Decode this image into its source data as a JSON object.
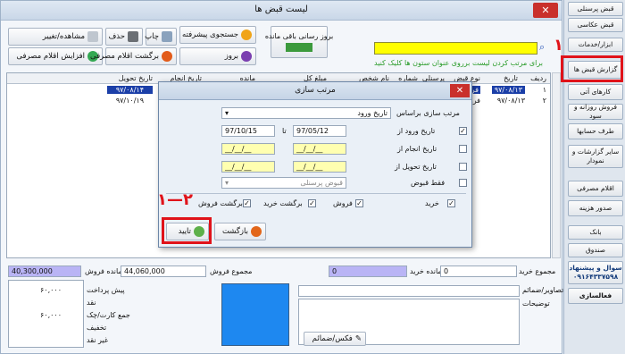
{
  "window": {
    "title": "لیست قبض ها",
    "close": "✕"
  },
  "toolbar": {
    "view_edit": "مشاهده/تغییر",
    "delete": "حذف",
    "print": "چاپ",
    "advanced_search": "جستجوی پیشرفته",
    "remaining_update": "بروز رسانی باقی مانده",
    "add_consumables": "افزایش اقلام مصرفی",
    "return_consumables": "برگشت اقلام مصرفی",
    "update": "بروز",
    "sort_hint": "برای مرتب کردن لیست برروی عنوان ستون ها کلیک کنید"
  },
  "grid": {
    "columns": [
      "ردیف",
      "تاریخ",
      "نوع قبض",
      "پرسنلی",
      "شماره",
      "نام شخص",
      "مبلغ کل",
      "مانده",
      "تاریخ انجام",
      "تاریخ تحویل"
    ],
    "rows": [
      {
        "idx": "۱",
        "date": "۹۷/۰۸/۱۳",
        "type": "فروش",
        "delivery": "۹۷/۰۸/۱۴"
      },
      {
        "idx": "۲",
        "date": "۹۷/۰۸/۱۳",
        "type": "فروش",
        "delivery": "۹۷/۱۰/۱۹"
      }
    ]
  },
  "dialog": {
    "title": "مرتب سازی",
    "sort_label": "مرتب سازی براساس",
    "sort_value": "تاریخ ورود",
    "entry_date": "تاریخ ورود از",
    "entry_from": "97/05/12",
    "entry_to": "97/10/15",
    "to": "تا",
    "done_date": "تاریخ انجام از",
    "delivery_date": "تاریخ تحویل از",
    "empty_date": "__/__/__",
    "only_receipts": "فقط قبوض",
    "personnel": "قبوض پرسنلی",
    "types": [
      "خرید",
      "فروش",
      "برگشت خرید",
      "برگشت فروش"
    ],
    "cancel": "بازگشت",
    "ok": "تایید"
  },
  "summary": {
    "total_purchase_label": "مجموع خرید",
    "total_purchase": "0",
    "remaining_purchase_label": "مانده خرید",
    "remaining_purchase": "0",
    "total_sales_label": "مجموع فروش",
    "total_sales": "44,060,000",
    "remaining_sales_label": "مانده فروش",
    "remaining_sales": "40,300,000",
    "prepayment": "پیش پرداخت",
    "prepayment_val": "۶۰,۰۰۰",
    "cash": "نقد",
    "card": "جمع کارت/چک",
    "card_val": "۶۰,۰۰۰",
    "discount": "تخفیف",
    "noncash": "غیر نقد",
    "image_path": "مسیر تصاویر/ضمائم",
    "notes": "توضیحات",
    "fax": "فکس/ضمائم"
  },
  "sidebar": {
    "items": [
      "قبض پرسنلی",
      "قبض عکاسی",
      "ابزار/خدمات",
      "گزارش قبض ها",
      "کارهای آتی",
      "فروش روزانه و سود",
      "طرف حسابها",
      "سایر گزارشات و نمودار",
      "اقلام مصرفی",
      "صدور هزینه",
      "بانک",
      "صندوق"
    ],
    "suggest_title": "سوال و پیشنهاد",
    "phone": "۰۹۱۶۴۳۳۷۵۹۸",
    "activate": "فعالسازی"
  },
  "annotations": {
    "step1": "۱",
    "step12": "۱—۲"
  },
  "colors": {
    "accent_red": "#e0131a",
    "selection_blue": "#1b3fa8",
    "purple_field": "#b9b4f5",
    "yellow_field": "#ffff66"
  }
}
